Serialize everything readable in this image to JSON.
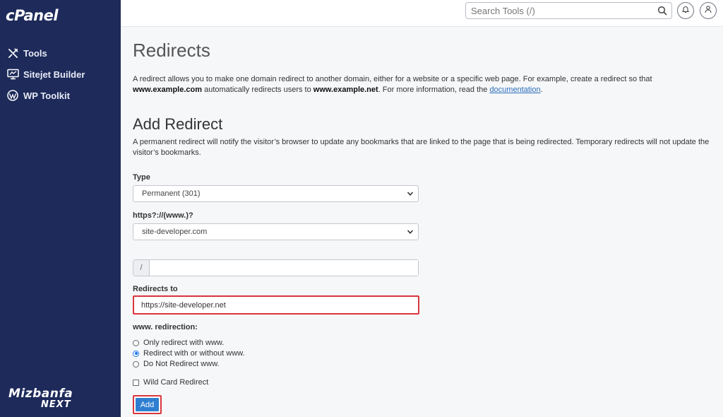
{
  "sidebar": {
    "logo": "cPanel",
    "items": [
      {
        "label": "Tools",
        "icon": "tools-icon"
      },
      {
        "label": "Sitejet Builder",
        "icon": "sitejet-icon"
      },
      {
        "label": "WP Toolkit",
        "icon": "wordpress-icon"
      }
    ],
    "brand_line1": "Mizbanfa",
    "brand_line2": "NEXT"
  },
  "topbar": {
    "search_placeholder": "Search Tools (/)",
    "icons": [
      "search-icon",
      "bell-icon",
      "user-icon"
    ]
  },
  "page": {
    "title": "Redirects",
    "intro_part1": "A redirect allows you to make one domain redirect to another domain, either for a website or a specific web page. For example, create a redirect so that",
    "intro_bold1": "www.example.com",
    "intro_part2": "automatically redirects users to",
    "intro_bold2": "www.example.net",
    "intro_part3": ". For more information, read the",
    "intro_link": "documentation",
    "intro_end": "."
  },
  "form": {
    "heading": "Add Redirect",
    "description": "A permanent redirect will notify the visitor’s browser to update any bookmarks that are linked to the page that is being redirected. Temporary redirects will not update the visitor’s bookmarks.",
    "type_label": "Type",
    "type_value": "Permanent (301)",
    "domain_label": "https?://(www.)?",
    "domain_value": "site-developer.com",
    "path_prefix": "/",
    "path_value": "",
    "redirects_to_label": "Redirects to",
    "redirects_to_value": "https://site-developer.net",
    "www_label": "www. redirection:",
    "www_options": [
      {
        "label": "Only redirect with www.",
        "selected": false
      },
      {
        "label": "Redirect with or without www.",
        "selected": true
      },
      {
        "label": "Do Not Redirect www.",
        "selected": false
      }
    ],
    "wildcard_label": "Wild Card Redirect",
    "wildcard_checked": false,
    "submit_label": "Add"
  },
  "colors": {
    "sidebar_bg": "#1d2a5a",
    "accent_blue": "#2e7fd0",
    "highlight_red": "#d9363e"
  }
}
